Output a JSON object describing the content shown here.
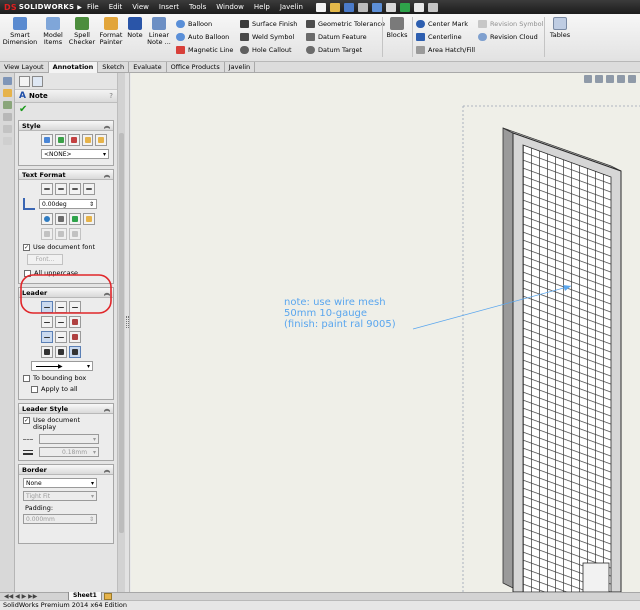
{
  "app": {
    "logo_brand": "DS",
    "logo_text": "SOLIDWORKS",
    "menu": [
      "File",
      "Edit",
      "View",
      "Insert",
      "Tools",
      "Window",
      "Help",
      "Javelin"
    ]
  },
  "ribbon": {
    "smart_dimension": "Smart\nDimension",
    "model_items": "Model\nItems",
    "spell_checker": "Spell\nChecker",
    "format_painter": "Format\nPainter",
    "note": "Note",
    "linear_note": "Linear\nNote ...",
    "balloon": "Balloon",
    "auto_balloon": "Auto Balloon",
    "magnetic_line": "Magnetic Line",
    "surface_finish": "Surface Finish",
    "weld_symbol": "Weld Symbol",
    "hole_callout": "Hole Callout",
    "geometric_tolerance": "Geometric Tolerance",
    "datum_feature": "Datum Feature",
    "datum_target": "Datum Target",
    "blocks": "Blocks",
    "center_mark": "Center Mark",
    "centerline": "Centerline",
    "area_hatch": "Area Hatch/Fill",
    "revision_symbol": "Revision Symbol",
    "revision_cloud": "Revision Cloud",
    "tables": "Tables"
  },
  "command_tabs": [
    "View Layout",
    "Annotation",
    "Sketch",
    "Evaluate",
    "Office Products",
    "Javelin"
  ],
  "property_manager": {
    "title": "Note",
    "help": "?",
    "style": {
      "header": "Style",
      "combo_value": "<NONE>"
    },
    "text_format": {
      "header": "Text Format",
      "angle_value": "0.00deg",
      "use_document_font": "Use document font",
      "font_button": "Font...",
      "all_uppercase": "All uppercase"
    },
    "leader": {
      "header": "Leader",
      "to_bounding_box": "To bounding box",
      "apply_to_all": "Apply to all"
    },
    "leader_style": {
      "header": "Leader Style",
      "use_document_display": "Use document\ndisplay",
      "thickness_value": "0.18mm"
    },
    "border": {
      "header": "Border",
      "combo_value": "None",
      "size_value": "Tight Fit",
      "padding_label": "Padding:",
      "padding_value": "0.000mm"
    }
  },
  "annotation": {
    "line1": "note: use wire mesh",
    "line2": "50mm 10-gauge",
    "line3": "(finish: paint ral 9005)"
  },
  "sheet_tab": "Sheet1",
  "status": "SolidWorks Premium 2014 x64 Edition",
  "colors": {
    "highlight_circle": "#e0262a",
    "note_text": "#5aa6ee",
    "canvas_bg": "#efefe8",
    "menu_bg": "#262626"
  }
}
